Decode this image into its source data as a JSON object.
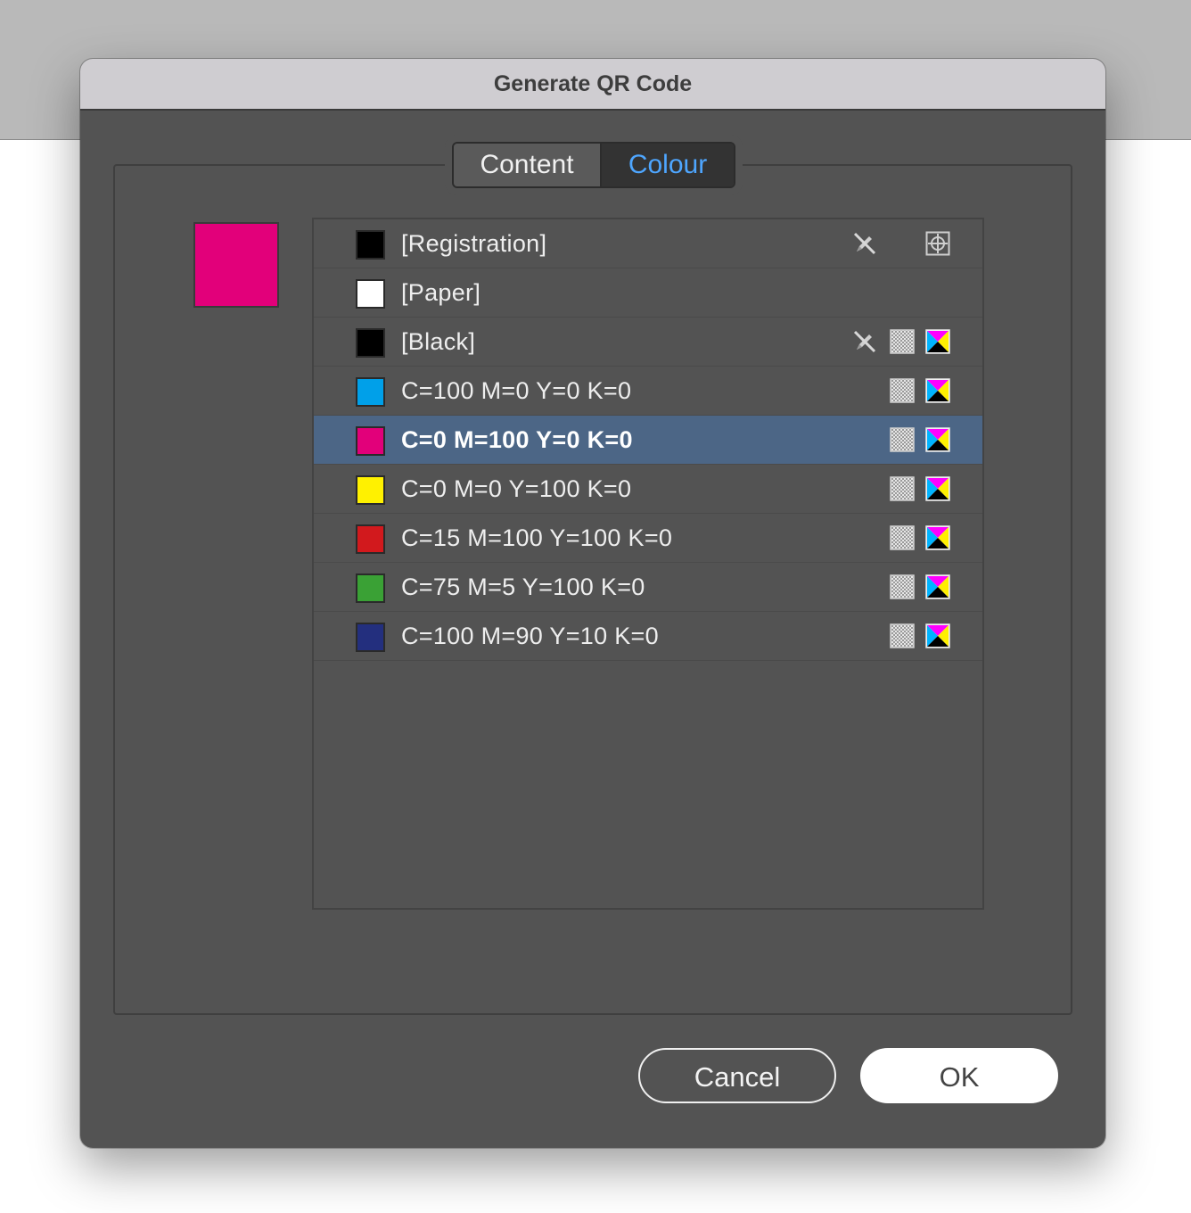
{
  "dialog": {
    "title": "Generate QR Code",
    "tabs": [
      {
        "label": "Content",
        "active": false
      },
      {
        "label": "Colour",
        "active": true
      }
    ],
    "preview_color": "#e2007a",
    "swatches": [
      {
        "label": "[Registration]",
        "color": "#000000",
        "icons": [
          "no-edit-icon",
          "registration-icon"
        ],
        "selected": false
      },
      {
        "label": "[Paper]",
        "color": "#ffffff",
        "icons": [],
        "selected": false
      },
      {
        "label": "[Black]",
        "color": "#000000",
        "icons": [
          "no-edit-icon",
          "process-color-icon",
          "cmyk-mode-icon"
        ],
        "selected": false
      },
      {
        "label": "C=100 M=0 Y=0 K=0",
        "color": "#00a0e9",
        "icons": [
          "process-color-icon",
          "cmyk-mode-icon"
        ],
        "selected": false
      },
      {
        "label": "C=0 M=100 Y=0 K=0",
        "color": "#e2007a",
        "icons": [
          "process-color-icon",
          "cmyk-mode-icon"
        ],
        "selected": true
      },
      {
        "label": "C=0 M=0 Y=100 K=0",
        "color": "#fff100",
        "icons": [
          "process-color-icon",
          "cmyk-mode-icon"
        ],
        "selected": false
      },
      {
        "label": "C=15 M=100 Y=100 K=0",
        "color": "#d2191d",
        "icons": [
          "process-color-icon",
          "cmyk-mode-icon"
        ],
        "selected": false
      },
      {
        "label": "C=75 M=5 Y=100 K=0",
        "color": "#3aa135",
        "icons": [
          "process-color-icon",
          "cmyk-mode-icon"
        ],
        "selected": false
      },
      {
        "label": "C=100 M=90 Y=10 K=0",
        "color": "#232f7e",
        "icons": [
          "process-color-icon",
          "cmyk-mode-icon"
        ],
        "selected": false
      }
    ],
    "buttons": {
      "cancel": "Cancel",
      "ok": "OK"
    },
    "colors": {
      "dialog_bg": "#535353",
      "selection": "#4c6686",
      "active_tab_text": "#4ea6ff"
    }
  }
}
